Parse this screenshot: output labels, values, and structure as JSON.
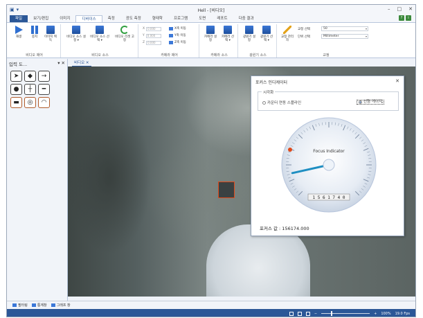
{
  "window": {
    "title": "Hell - [비디오]",
    "controls": [
      "–",
      "□",
      "✕"
    ]
  },
  "tabs": [
    "파일",
    "보기/편집",
    "이미지",
    "디바이스",
    "측정",
    "광도 측정",
    "형태학",
    "프로그램",
    "도면",
    "레포트",
    "다중 결과"
  ],
  "ribbon": {
    "video_control": {
      "label": "비디오 제어",
      "play": "재생",
      "stop": "중지",
      "capture": "이미지 획득"
    },
    "video_source": {
      "label": "비디오 소스",
      "settings": "비디오 소스 설정 ▾",
      "select": "비디오 소스 선택 ▾",
      "reset": "비디오 리셋 고정"
    },
    "camera_control": {
      "label": "카메라 제어",
      "fields": [
        {
          "key": "X",
          "value": "0.000"
        },
        {
          "key": "Y",
          "value": "0.000"
        },
        {
          "key": "Z",
          "value": "0.000"
        }
      ],
      "moves": [
        "X축 이동",
        "Y축 이동",
        "Z축 이동"
      ]
    },
    "camera_source": {
      "label": "카메라 소스",
      "settings": "카메라 설정",
      "select": "카메라 선택 ▾"
    },
    "lighting_source": {
      "label": "광원기 소스",
      "settings": "광원기 설정",
      "select": "광원기 선택 ▾"
    },
    "calibration": {
      "label": "교정",
      "button": "교정 관리자",
      "select_label": "교정 선택",
      "select_value": "50",
      "unit_label": "단위 선택",
      "unit_value": "Millimeter"
    }
  },
  "tool_panel": {
    "title": "입력 도...",
    "controls": "▾ ✕"
  },
  "doc_tab": "비디오 ✕",
  "dialog": {
    "title": "포커스 인디케이터",
    "close": "✕",
    "group_label": "시각화",
    "option1": "카운터 연동 스플라인",
    "option2": "선형 게이지",
    "gauge_title": "Focus Indicator",
    "counter": "1 5 6 1 7 4 0",
    "value_label": "포커스 값 : 156174.000",
    "needle_fraction": 0.12
  },
  "bottom_items": [
    "필터링",
    "통계창",
    "그래프 창"
  ],
  "status": {
    "zoom": "100%",
    "fps": "19.0 Fps"
  },
  "colors": {
    "accent": "#2b5797",
    "status_bg": "#2b5797",
    "focus_box": "#e04a1a"
  }
}
